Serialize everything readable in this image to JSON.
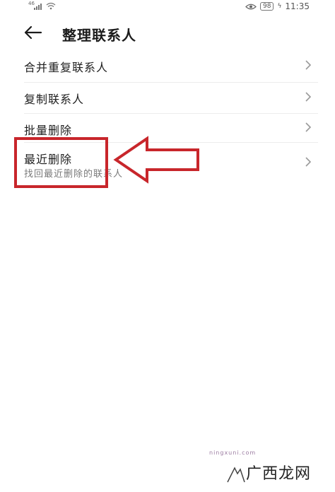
{
  "status_bar": {
    "network_label": "46",
    "battery": "98",
    "time": "11:35",
    "icons": [
      "signal-icon",
      "wifi-icon",
      "eye-comfort-icon",
      "battery-icon",
      "charging-icon"
    ]
  },
  "header": {
    "back_icon": "arrow-left-icon",
    "title": "整理联系人"
  },
  "list": {
    "items": [
      {
        "label": "合并重复联系人",
        "icon": "chevron-right-icon"
      },
      {
        "label": "复制联系人",
        "icon": "chevron-right-icon"
      },
      {
        "label": "批量删除",
        "icon": "chevron-right-icon"
      },
      {
        "label": "最近删除",
        "subtitle": "找回最近删除的联系人",
        "icon": "chevron-right-icon"
      }
    ]
  },
  "annotation": {
    "highlight_color": "#c8262b",
    "arrow_icon": "red-arrow-left-icon"
  },
  "watermark": {
    "text": "广西龙网",
    "url": "ningxuni.com",
    "logo_icon": "watermark-logo-icon"
  }
}
